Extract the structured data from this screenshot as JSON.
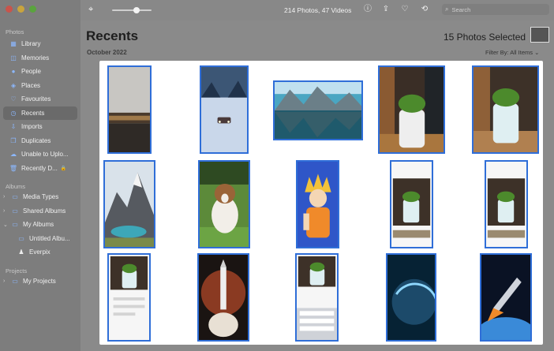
{
  "sidebar": {
    "photos_section": "Photos",
    "albums_section": "Albums",
    "projects_section": "Projects",
    "items": [
      {
        "label": "Library",
        "icon": "library-icon"
      },
      {
        "label": "Memories",
        "icon": "memories-icon"
      },
      {
        "label": "People",
        "icon": "people-icon"
      },
      {
        "label": "Places",
        "icon": "places-icon"
      },
      {
        "label": "Favourites",
        "icon": "heart-icon"
      },
      {
        "label": "Recents",
        "icon": "recents-icon"
      },
      {
        "label": "Imports",
        "icon": "imports-icon"
      },
      {
        "label": "Duplicates",
        "icon": "duplicates-icon"
      },
      {
        "label": "Unable to Uplo...",
        "icon": "cloud-icon"
      },
      {
        "label": "Recently D...",
        "icon": "trash-icon"
      }
    ],
    "albums": [
      {
        "label": "Media Types"
      },
      {
        "label": "Shared Albums"
      },
      {
        "label": "My Albums"
      },
      {
        "label": "Untitled Albu..."
      },
      {
        "label": "Everpix"
      }
    ],
    "projects": [
      {
        "label": "My Projects"
      }
    ]
  },
  "toolbar": {
    "count": "214 Photos, 47 Videos",
    "search_placeholder": "Search"
  },
  "main": {
    "title": "Recents",
    "month": "October 2022",
    "selected": "15 Photos Selected",
    "filter": "Filter By: All Items"
  },
  "photos": [
    {
      "name": "photo-desert-lake"
    },
    {
      "name": "photo-snowy-road"
    },
    {
      "name": "photo-mountain-lake"
    },
    {
      "name": "photo-plant-pot-1"
    },
    {
      "name": "photo-plant-pot-2"
    },
    {
      "name": "photo-mountain-peak"
    },
    {
      "name": "photo-dog"
    },
    {
      "name": "photo-anime-character"
    },
    {
      "name": "photo-phone-screenshot-1"
    },
    {
      "name": "photo-phone-screenshot-2"
    },
    {
      "name": "photo-phone-screenshot-3"
    },
    {
      "name": "photo-rocket-launch"
    },
    {
      "name": "photo-phone-keyboard"
    },
    {
      "name": "photo-earth-space"
    },
    {
      "name": "photo-rocket-space"
    }
  ]
}
